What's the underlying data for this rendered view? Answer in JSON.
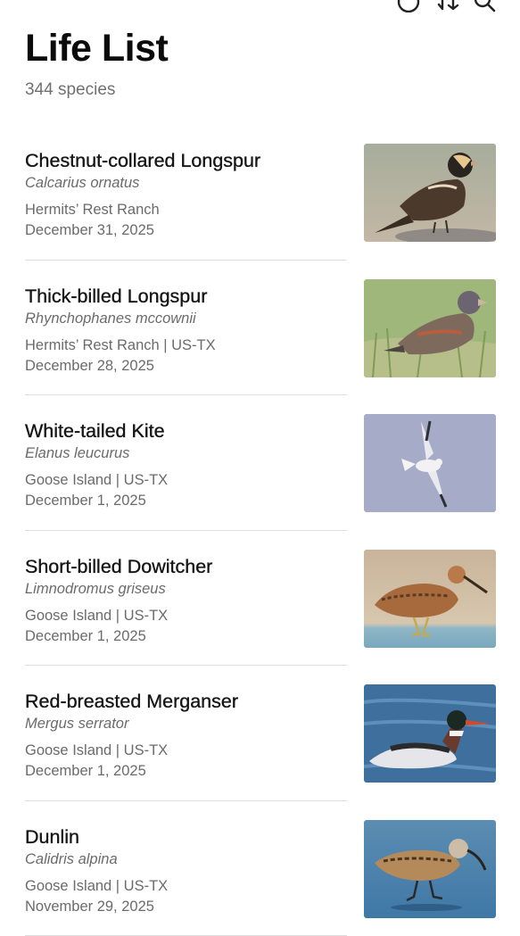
{
  "header": {
    "title": "Life List",
    "species_count": "344 species"
  },
  "species": [
    {
      "common_name": "Chestnut-collared Longspur",
      "scientific_name": "Calcarius ornatus",
      "location": "Hermits’ Rest Ranch",
      "date": "December 31, 2025"
    },
    {
      "common_name": "Thick-billed Longspur",
      "scientific_name": "Rhynchophanes mccownii",
      "location": "Hermits’ Rest Ranch | US-TX",
      "date": "December 28, 2025"
    },
    {
      "common_name": "White-tailed Kite",
      "scientific_name": "Elanus leucurus",
      "location": "Goose Island | US-TX",
      "date": "December 1, 2025"
    },
    {
      "common_name": "Short-billed Dowitcher",
      "scientific_name": "Limnodromus griseus",
      "location": "Goose Island | US-TX",
      "date": "December 1, 2025"
    },
    {
      "common_name": "Red-breasted Merganser",
      "scientific_name": "Mergus serrator",
      "location": "Goose Island | US-TX",
      "date": "December 1, 2025"
    },
    {
      "common_name": "Dunlin",
      "scientific_name": "Calidris alpina",
      "location": "Goose Island | US-TX",
      "date": "November 29, 2025"
    }
  ],
  "icons": {
    "top_bar": [
      "info-icon",
      "sort-icon",
      "search-icon"
    ]
  },
  "colors": {
    "title": "#0b0b0b",
    "secondary_text": "#6b6b6b",
    "divider": "#dedede",
    "background": "#ffffff"
  }
}
